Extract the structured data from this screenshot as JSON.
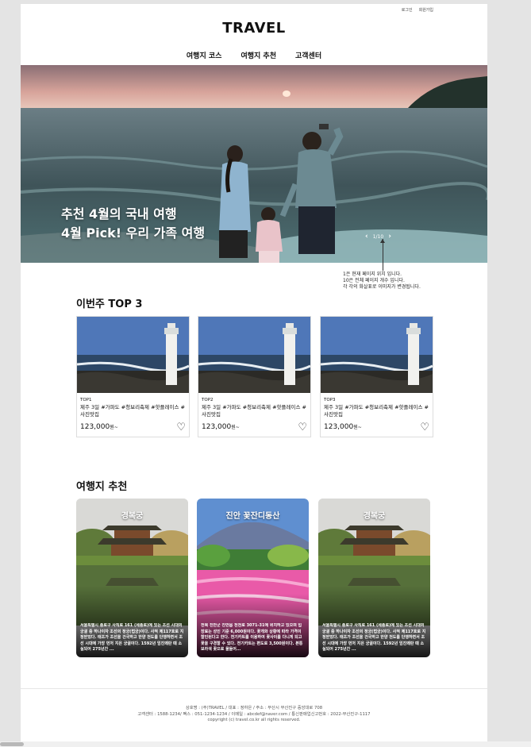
{
  "header": {
    "utility": [
      "로그인",
      "회원가입"
    ],
    "logo": "TRAVEL",
    "nav": [
      "여행지 코스",
      "여행지 추천",
      "고객센터"
    ]
  },
  "hero": {
    "title_line1": "추천 4월의 국내 여행",
    "title_line2": "4월 Pick! 우리 가족 여행",
    "page_indicator": "1/10",
    "prev_icon": "chevron-left-icon",
    "next_icon": "chevron-right-icon"
  },
  "annotation": {
    "line1": "1은 현재 페이지 위치 입니다.",
    "line2": "10은 전체 페이지 개수 입니다.",
    "line3": "각 각의 화살표로 이미지가 변경됩니다."
  },
  "top3": {
    "title": "이번주 TOP 3",
    "cards": [
      {
        "rank": "TOP1",
        "tags": "제주 3일 #가파도 #청보리축제 #핫플레이스 #사진맛집",
        "price": "123,000",
        "unit": "원~",
        "icon": "heart-icon"
      },
      {
        "rank": "TOP2",
        "tags": "제주 3일 #가파도 #청보리축제 #핫플레이스 #사진맛집",
        "price": "123,000",
        "unit": "원~",
        "icon": "heart-icon"
      },
      {
        "rank": "TOP3",
        "tags": "제주 3일 #가파도 #청보리축제 #핫플레이스 #사진맛집",
        "price": "123,000",
        "unit": "원~",
        "icon": "heart-icon"
      }
    ]
  },
  "recommend": {
    "title": "여행지 추천",
    "cards": [
      {
        "name": "경복궁",
        "desc": "서울특별시 종로구 사직로 161 (세종로)에 있는 조선 시대의 궁궐 중 하나이자 조선의 정궁(법궁)이다. 사적 제117호로 지정받았다. 태조가 조선을 건국하고 한양 천도를 단행하면서 조선 시대에 가장 먼저 지은 궁궐이다. 1592년 임진왜란 때 소실되어 275년간 ..."
      },
      {
        "name": "진안 꽃잔디동산",
        "desc": "전북 진안군 진안읍 천천로 3071-31에 위치하고 있으며 입장료는 성인 기준 6,000원이다. 꽃개화 상황에 따라 가격이 할인된다고 한다. 전기카트를 이용하여 꽃사이를 다니게 되고 꽃을 구경할 수 있다. 전기카트는 편도로 3,500원이다. 본통 보라색 꽃으로 물들어..."
      },
      {
        "name": "경복궁",
        "desc": "서울특별시 종로구 사직로 161 (세종로)에 있는 조선 시대의 궁궐 중 하나이자 조선의 정궁(법궁)이다. 사적 제117호로 지정받았다. 태조가 조선을 건국하고 한양 천도를 단행하면서 조선 시대에 가장 먼저 지은 궁궐이다. 1592년 임진왜란 때 소실되어 275년간 ..."
      }
    ]
  },
  "footer": {
    "line1": "상호명 : (주)TRAVEL / 대표 : 정하은 / 주소 : 부산시 부산진구 중앙대로 708",
    "line2": "고객센터 : 1588-1234/ 팩스 : 051-1234-1234 / 이메일 : abcdef@naver.com / 통신판매업신고번호 : 2022-부산진구-1117",
    "line3": "copyright (c) travel.co.kr all rights reserved."
  },
  "colors": {
    "page_bg": "#ffffff",
    "outer_bg": "#e4e4e4",
    "text": "#111111"
  }
}
